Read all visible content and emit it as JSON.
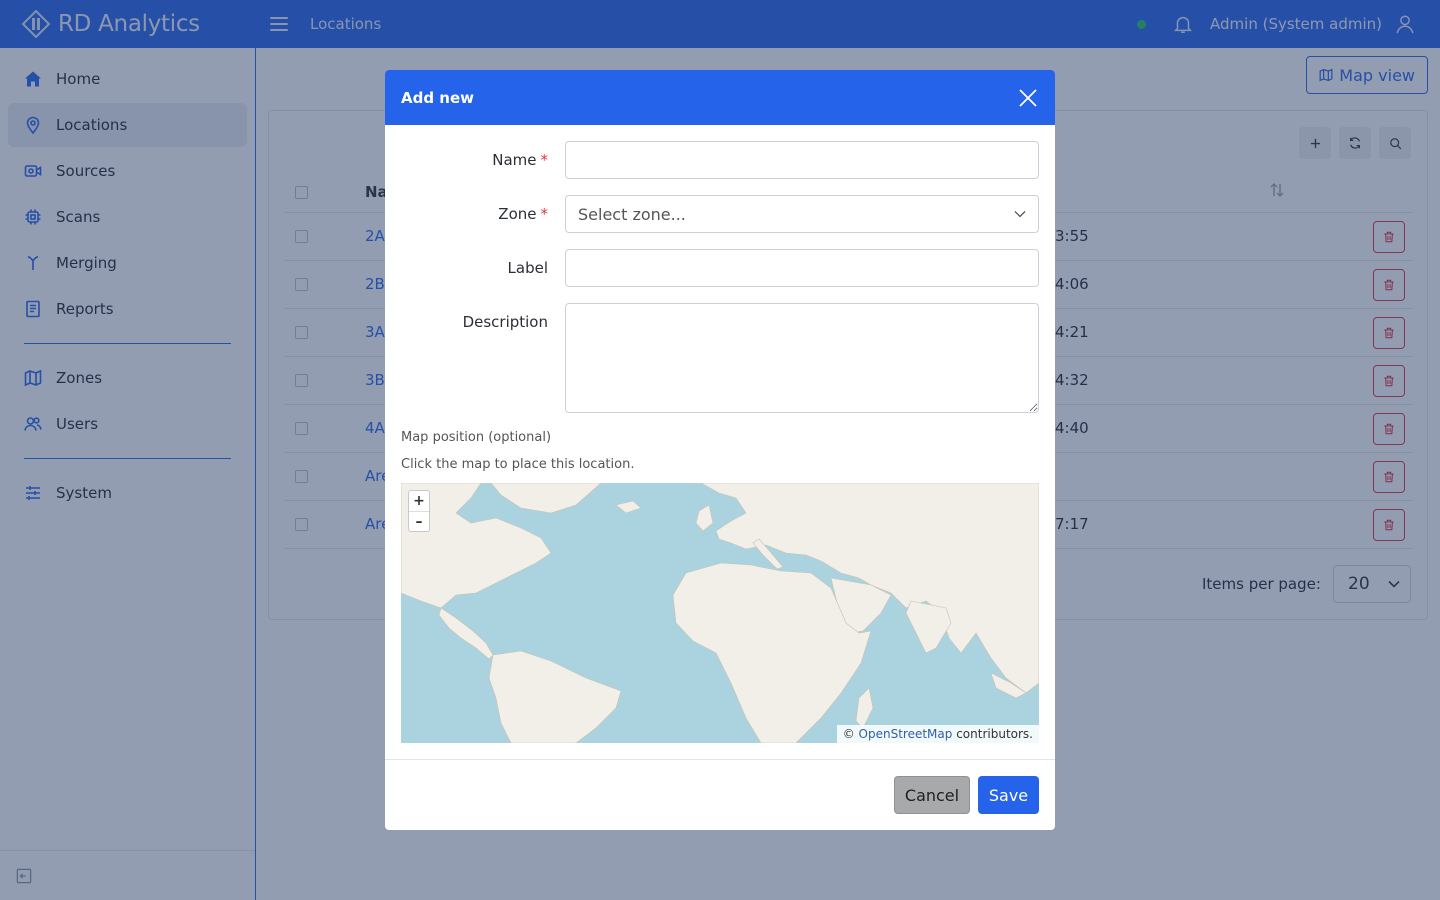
{
  "app": {
    "brand": "RD Analytics"
  },
  "header": {
    "breadcrumb": "Locations",
    "user_label": "Admin (System admin)",
    "status_color": "#22c55e"
  },
  "sidebar": {
    "items": [
      {
        "label": "Home",
        "icon": "home-icon"
      },
      {
        "label": "Locations",
        "icon": "map-pin-icon",
        "active": true
      },
      {
        "label": "Sources",
        "icon": "camera-icon"
      },
      {
        "label": "Scans",
        "icon": "chip-icon"
      },
      {
        "label": "Merging",
        "icon": "merge-icon"
      },
      {
        "label": "Reports",
        "icon": "report-icon"
      },
      {
        "label": "Zones",
        "icon": "map-icon"
      },
      {
        "label": "Users",
        "icon": "users-icon"
      },
      {
        "label": "System",
        "icon": "sliders-icon"
      }
    ]
  },
  "main": {
    "map_view_label": "Map view",
    "table": {
      "header_name": "Na",
      "rows": [
        {
          "name": "2A",
          "time": "3:55"
        },
        {
          "name": "2B",
          "time": "4:06"
        },
        {
          "name": "3A",
          "time": "4:21"
        },
        {
          "name": "3B",
          "time": "4:32"
        },
        {
          "name": "4A",
          "time": "4:40"
        },
        {
          "name": "Are",
          "time": ""
        },
        {
          "name": "Are",
          "time": "7:17"
        }
      ]
    },
    "items_per_page_label": "Items per page:",
    "items_per_page_value": "20"
  },
  "modal": {
    "title": "Add new",
    "fields": {
      "name_label": "Name",
      "zone_label": "Zone",
      "zone_placeholder": "Select zone...",
      "label_label": "Label",
      "description_label": "Description",
      "required_mark": "*"
    },
    "map_position_label": "Map position (optional)",
    "map_hint": "Click the map to place this location.",
    "zoom_in": "+",
    "zoom_out": "–",
    "attribution_prefix": "©",
    "attribution_link": "OpenStreetMap",
    "attribution_suffix": "contributors.",
    "cancel_label": "Cancel",
    "save_label": "Save"
  },
  "colors": {
    "primary": "#2563eb",
    "danger": "#dc3545",
    "water": "#aad3df",
    "land": "#f2efe9"
  }
}
